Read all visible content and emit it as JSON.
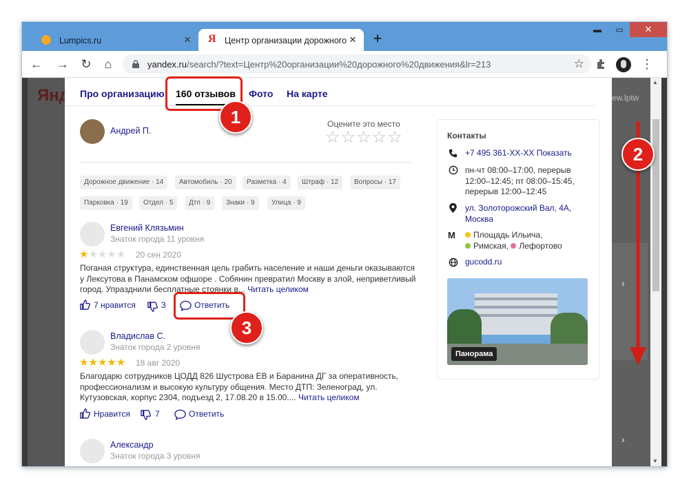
{
  "browser": {
    "tabs": [
      {
        "title": "Lumpics.ru",
        "favicon": "lumpics-orange-circle",
        "active": false
      },
      {
        "title": "Центр организации дорожного",
        "favicon": "yandex-ya",
        "active": true
      }
    ],
    "new_tab": "+",
    "close_glyph": "✕",
    "window_controls": {
      "minimize": "▬",
      "maximize": "▭",
      "close": "✕"
    },
    "nav": {
      "back": "←",
      "forward": "→",
      "reload": "↻",
      "home": "⌂"
    },
    "url_host": "yandex.ru",
    "url_rest": "/search/?text=Центр%20организации%20дорожного%20движения&lr=213",
    "star": "☆",
    "extensions_icon": "puzzle-icon",
    "menu_icon": "⋮"
  },
  "background_page": {
    "logo": "Янд",
    "right_fragments": [
      "ew.lptw"
    ]
  },
  "org_tabs": [
    {
      "label": "Про организацию"
    },
    {
      "label": "160 отзывов"
    },
    {
      "label": "Фото"
    },
    {
      "label": "На карте"
    }
  ],
  "own_review": {
    "author": "Андрей П.",
    "rate_prompt": "Оцените это место",
    "empty_stars": "☆☆☆☆☆"
  },
  "filter_chips": [
    "Дорожное движение · 14",
    "Автомобиль · 20",
    "Разметка · 4",
    "Штраф · 12",
    "Вопросы · 17",
    "Парковка · 19",
    "Отдел · 5",
    "Дтп · 9",
    "Знаки · 9",
    "Улица · 9"
  ],
  "reviews": [
    {
      "author": "Евгений Клязьмин",
      "level": "Знаток города 11 уровня",
      "rating": 1,
      "stars_filled": "★",
      "stars_empty": "★★★★",
      "date": "20 сен 2020",
      "text_lines": [
        "Поганая структура, единственная цель грабить население и наши деньги оказываются",
        "у Лекcутова в Панамском офшоре . Собянин превратил Москву в злой, неприветливый",
        "город. Упразднили бесплатные стоянки в..."
      ],
      "read_more": "Читать целиком",
      "likes": "7 нравится",
      "dislikes": "3",
      "reply": "Ответить"
    },
    {
      "author": "Владислав С.",
      "level": "Знаток города 2 уровня",
      "rating": 5,
      "stars_filled": "★★★★★",
      "stars_empty": "",
      "date": "18 авг 2020",
      "text_lines": [
        "Благодарю сотрудников ЦОДД 826 Шустрова ЕВ и Баранина ДГ за оперативность,",
        "профессионализм и высокую культуру общения. Место ДТП: Зеленоград, ул.",
        "Кутузовская, корпус 2304, подъезд 2, 17.08.20 в 15.00...."
      ],
      "read_more": "Читать целиком",
      "likes": "Нравится",
      "dislikes": "7",
      "reply": "Ответить"
    },
    {
      "author": "Александр",
      "level": "Знаток города 3 уровня"
    }
  ],
  "contacts": {
    "title": "Контакты",
    "phone": "+7 495 361-XX-XX Показать",
    "hours": [
      "пн-чт 08:00–17:00, перерыв",
      "12:00–12:45; пт 08:00–15:45,",
      "перерыв 12:00–12:45"
    ],
    "address": [
      "ул. Золоторожский Вал, 4А,",
      "Москва"
    ],
    "metro": [
      {
        "name": "Площадь Ильича",
        "color": "#f5c518"
      },
      {
        "name": "Римская",
        "color": "#8dc63f"
      },
      {
        "name": "Лефортово",
        "color": "#e57399"
      }
    ],
    "site": "gucodd.ru",
    "panorama_label": "Панорама"
  },
  "callouts": [
    "1",
    "2",
    "3"
  ],
  "colors": {
    "accent_red": "#e0201a",
    "link": "#1a1a8a",
    "titlebar": "#5d9cd8"
  }
}
